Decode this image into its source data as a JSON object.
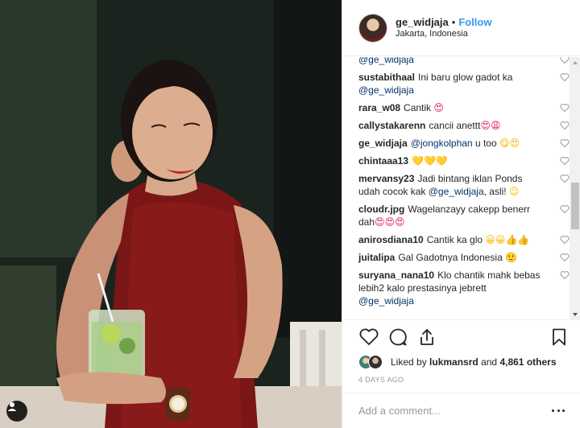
{
  "post": {
    "username": "ge_widjaja",
    "separator": "•",
    "follow_label": "Follow",
    "location": "Jakarta, Indonesia"
  },
  "comments": [
    {
      "user": "",
      "text": "@ge_widjaja",
      "mention": true,
      "emoji": ""
    },
    {
      "user": "sustabithaal",
      "text": "Ini baru glow gadot ka",
      "mention2": "@ge_widjaja",
      "emoji": ""
    },
    {
      "user": "rara_w08",
      "text": "Cantik",
      "emoji": "😍"
    },
    {
      "user": "callystakarenn",
      "text": "cancii anettt",
      "emoji": "😍😩"
    },
    {
      "user": "ge_widjaja",
      "text": "u too",
      "mention_inline": "@jongkolphan",
      "emoji": "😋😍"
    },
    {
      "user": "chintaaa13",
      "text": "",
      "emoji": "💛💛💛"
    },
    {
      "user": "mervansy23",
      "text": "Jadi bintang iklan Ponds udah cocok kak",
      "mention3": "@ge_widjaja",
      "text2": ", asli!",
      "emoji": "😉"
    },
    {
      "user": "cloudr.jpg",
      "text": "Wagelanzayy cakepp benerr dah",
      "emoji": "😍😍😍"
    },
    {
      "user": "anirosdiana10",
      "text": "Cantik ka glo",
      "emoji": "😀😀👍👍"
    },
    {
      "user": "juitalipa",
      "text": "Gal Gadotnya Indonesia",
      "emoji": "🙂"
    },
    {
      "user": "suryana_nana10",
      "text": "Klo chantik mahk bebas lebih2 kalo prestasinya jebrett",
      "mention4": "@ge_widjaja",
      "emoji": ""
    }
  ],
  "likes": {
    "prefix": "Liked by",
    "user": "lukmansrd",
    "and": "and",
    "count": "4,861 others"
  },
  "time_label": "4 DAYS AGO",
  "add_comment": {
    "placeholder": "Add a comment..."
  },
  "icons": {
    "like": "heart-icon",
    "comment": "comment-icon",
    "share": "share-icon",
    "save": "bookmark-icon",
    "more": "more-icon",
    "user_tag": "user-tag-icon"
  },
  "colors": {
    "accent": "#3897f0",
    "mention": "#003569",
    "text": "#262626",
    "muted": "#999999"
  }
}
